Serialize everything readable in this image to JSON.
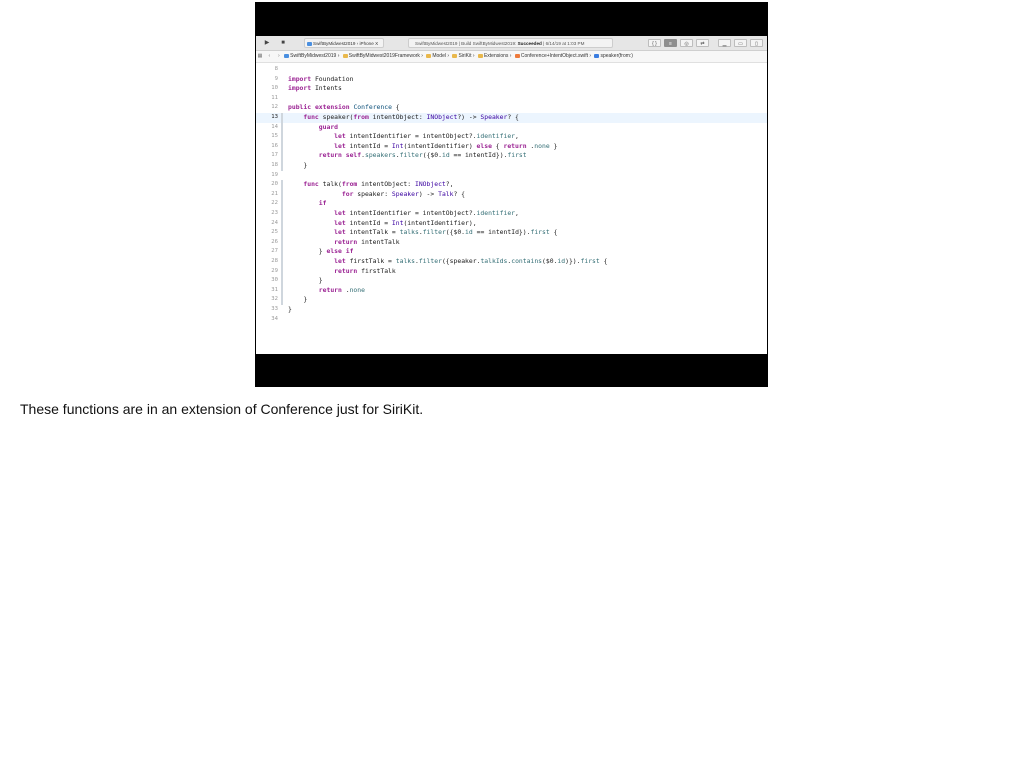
{
  "caption": "These functions are in an extension of Conference just for SiriKit.",
  "toolbar": {
    "run_icon": "play-icon",
    "stop_icon": "stop-icon",
    "scheme": "SwiftByMidwest2019",
    "device": "iPhone X",
    "status_project": "SwiftByMidwest2019",
    "status_build": "Build SwiftByMidwest2019:",
    "status_result": "Succeeded",
    "status_time": "6/14/19 at 1:03 PM"
  },
  "jumpbar": {
    "items": [
      "SwiftByMidwest2019",
      "SwiftByMidwest2019Framework",
      "Model",
      "SiriKit",
      "Extensions",
      "Conference+IntentObject.swift",
      "speaker(from:)"
    ]
  },
  "colors": {
    "keyword": "#9b2393",
    "type": "#3900a0",
    "property": "#326d74",
    "current_line": "#ecf5fe"
  },
  "code": {
    "lines": [
      {
        "n": "8",
        "t": ""
      },
      {
        "n": "9",
        "t": "import Foundation"
      },
      {
        "n": "10",
        "t": "import Intents"
      },
      {
        "n": "11",
        "t": ""
      },
      {
        "n": "12",
        "t": "public extension Conference {"
      },
      {
        "n": "13",
        "t": "    func speaker(from intentObject: INObject?) -> Speaker? {"
      },
      {
        "n": "14",
        "t": "        guard"
      },
      {
        "n": "15",
        "t": "            let intentIdentifier = intentObject?.identifier,"
      },
      {
        "n": "16",
        "t": "            let intentId = Int(intentIdentifier) else { return .none }"
      },
      {
        "n": "17",
        "t": "        return self.speakers.filter({$0.id == intentId}).first"
      },
      {
        "n": "18",
        "t": "    }"
      },
      {
        "n": "19",
        "t": ""
      },
      {
        "n": "20",
        "t": "    func talk(from intentObject: INObject?,"
      },
      {
        "n": "21",
        "t": "              for speaker: Speaker) -> Talk? {"
      },
      {
        "n": "22",
        "t": "        if"
      },
      {
        "n": "23",
        "t": "            let intentIdentifier = intentObject?.identifier,"
      },
      {
        "n": "24",
        "t": "            let intentId = Int(intentIdentifier),"
      },
      {
        "n": "25",
        "t": "            let intentTalk = talks.filter({$0.id == intentId}).first {"
      },
      {
        "n": "26",
        "t": "            return intentTalk"
      },
      {
        "n": "27",
        "t": "        } else if"
      },
      {
        "n": "28",
        "t": "            let firstTalk = talks.filter({speaker.talkIds.contains($0.id)}).first {"
      },
      {
        "n": "29",
        "t": "            return firstTalk"
      },
      {
        "n": "30",
        "t": "        }"
      },
      {
        "n": "31",
        "t": "        return .none"
      },
      {
        "n": "32",
        "t": "    }"
      },
      {
        "n": "33",
        "t": "}"
      },
      {
        "n": "34",
        "t": ""
      }
    ]
  }
}
